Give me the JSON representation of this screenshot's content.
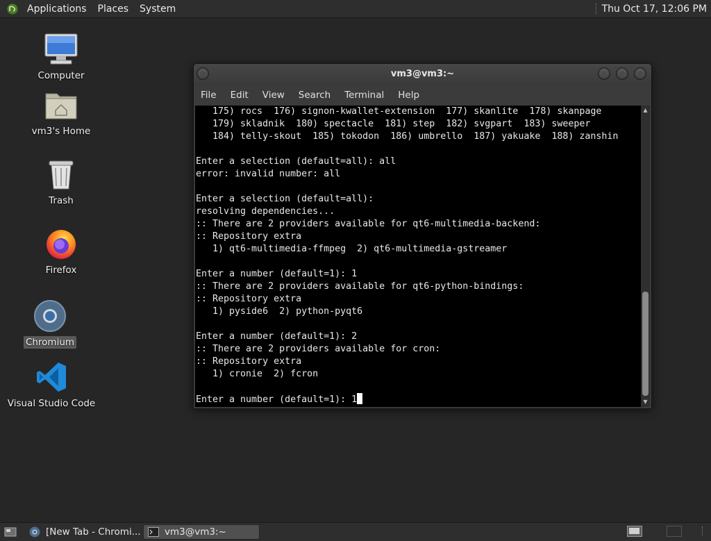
{
  "top_panel": {
    "menus": [
      "Applications",
      "Places",
      "System"
    ],
    "clock": "Thu Oct 17, 12:06 PM"
  },
  "desktop": {
    "icons": [
      {
        "label": "Computer",
        "icon": "computer-icon"
      },
      {
        "label": "vm3's Home",
        "icon": "home-folder-icon"
      },
      {
        "label": "Trash",
        "icon": "trash-icon"
      },
      {
        "label": "Firefox",
        "icon": "firefox-icon"
      },
      {
        "label": "Chromium",
        "icon": "chromium-icon",
        "selected": true
      },
      {
        "label": "Visual Studio Code",
        "icon": "vscode-icon"
      }
    ]
  },
  "terminal": {
    "title": "vm3@vm3:~",
    "menu": [
      "File",
      "Edit",
      "View",
      "Search",
      "Terminal",
      "Help"
    ],
    "lines": [
      "   175) rocs  176) signon-kwallet-extension  177) skanlite  178) skanpage",
      "   179) skladnik  180) spectacle  181) step  182) svgpart  183) sweeper",
      "   184) telly-skout  185) tokodon  186) umbrello  187) yakuake  188) zanshin",
      "",
      "Enter a selection (default=all): all",
      "error: invalid number: all",
      "",
      "Enter a selection (default=all):",
      "resolving dependencies...",
      ":: There are 2 providers available for qt6-multimedia-backend:",
      ":: Repository extra",
      "   1) qt6-multimedia-ffmpeg  2) qt6-multimedia-gstreamer",
      "",
      "Enter a number (default=1): 1",
      ":: There are 2 providers available for qt6-python-bindings:",
      ":: Repository extra",
      "   1) pyside6  2) python-pyqt6",
      "",
      "Enter a number (default=1): 2",
      ":: There are 2 providers available for cron:",
      ":: Repository extra",
      "   1) cronie  2) fcron",
      ""
    ],
    "prompt_line": "Enter a number (default=1): ",
    "typed_input": "1"
  },
  "taskbar": {
    "tasks": [
      {
        "label": "[New Tab - Chromi...",
        "icon": "chromium-icon",
        "active": false
      },
      {
        "label": "vm3@vm3:~",
        "icon": "terminal-icon",
        "active": true
      }
    ]
  }
}
